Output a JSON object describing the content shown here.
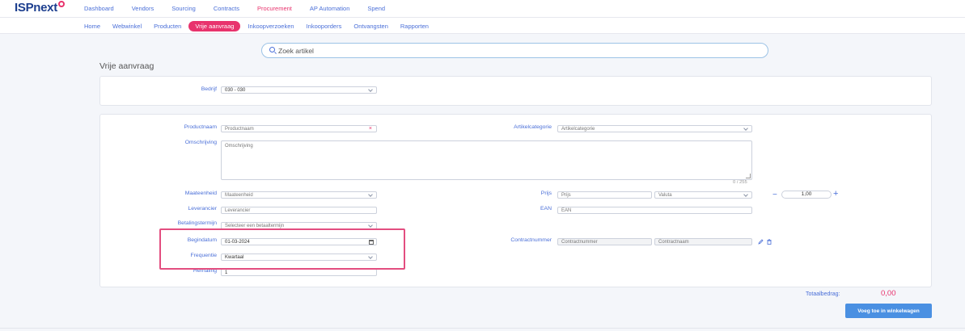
{
  "app": {
    "logo": "ISPnext"
  },
  "topnav": [
    {
      "label": "Dashboard",
      "active": false
    },
    {
      "label": "Vendors",
      "active": false
    },
    {
      "label": "Sourcing",
      "active": false
    },
    {
      "label": "Contracts",
      "active": false
    },
    {
      "label": "Procurement",
      "active": true
    },
    {
      "label": "AP Automation",
      "active": false
    },
    {
      "label": "Spend",
      "active": false
    }
  ],
  "subnav": [
    {
      "label": "Home",
      "active": false
    },
    {
      "label": "Webwinkel",
      "active": false
    },
    {
      "label": "Producten",
      "active": false
    },
    {
      "label": "Vrije aanvraag",
      "active": true
    },
    {
      "label": "Inkoopverzoeken",
      "active": false
    },
    {
      "label": "Inkooporders",
      "active": false
    },
    {
      "label": "Ontvangsten",
      "active": false
    },
    {
      "label": "Rapporten",
      "active": false
    }
  ],
  "search": {
    "placeholder": "Zoek artikel"
  },
  "page_title": "Vrije aanvraag",
  "form": {
    "bedrijf": {
      "label": "Bedrijf",
      "value": "030 - 030"
    },
    "productnaam": {
      "label": "Productnaam",
      "placeholder": "Productnaam",
      "required_mark": "×"
    },
    "artikelcategorie": {
      "label": "Artikelcategorie",
      "placeholder": "Artikelcategorie"
    },
    "omschrijving": {
      "label": "Omschrijving",
      "placeholder": "Omschrijving",
      "counter": "0 / 255"
    },
    "maateenheid": {
      "label": "Maateenheid",
      "placeholder": "Maateenheid"
    },
    "prijs": {
      "label": "Prijs",
      "placeholder": "Prijs",
      "valuta_placeholder": "Valuta",
      "quantity": "1,00",
      "minus": "−",
      "plus": "+"
    },
    "leverancier": {
      "label": "Leverancier",
      "placeholder": "Leverancier"
    },
    "ean": {
      "label": "EAN",
      "placeholder": "EAN"
    },
    "betalingstermijn": {
      "label": "Betalingstermijn",
      "placeholder": "Selecteer een betaaltermijn"
    },
    "begindatum": {
      "label": "Begindatum",
      "value": "01-03-2024"
    },
    "contractnummer": {
      "label": "Contractnummer",
      "placeholder": "Contractnummer",
      "naam_placeholder": "Contractnaam"
    },
    "frequentie": {
      "label": "Frequentie",
      "value": "Kwartaal"
    },
    "herhaling": {
      "label": "Herhaling",
      "value": "1"
    }
  },
  "totals": {
    "label": "Totaalbedrag:",
    "value": "0,00"
  },
  "actions": {
    "add_to_cart": "Voeg toe in winkelwagen"
  },
  "colors": {
    "accent": "#e8336d",
    "link": "#4a6fd8",
    "button": "#4a90e2",
    "highlight": "#e34e80"
  }
}
